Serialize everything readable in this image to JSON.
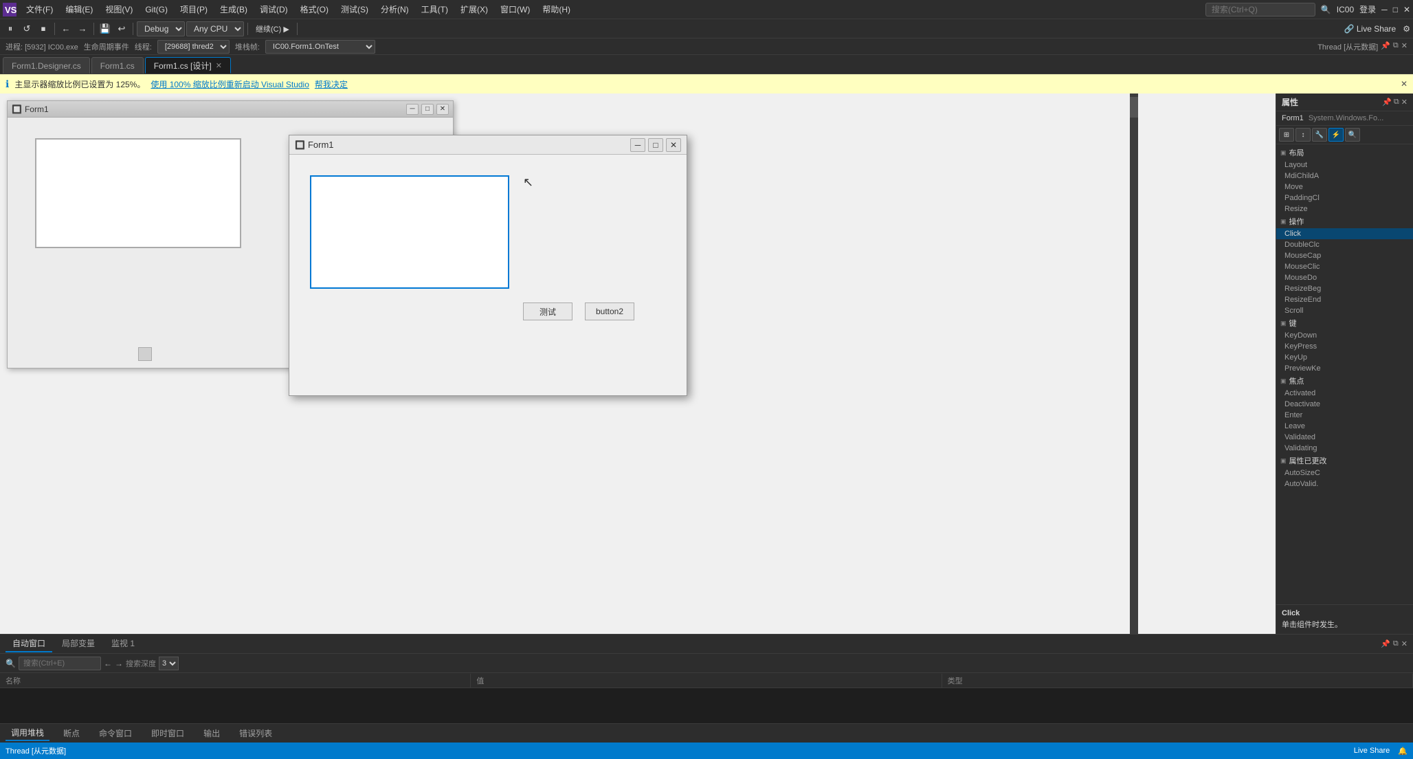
{
  "app": {
    "logo": "VS",
    "title": "Visual Studio"
  },
  "menu": {
    "items": [
      "文件(F)",
      "编辑(E)",
      "视图(V)",
      "Git(G)",
      "项目(P)",
      "生成(B)",
      "调试(D)",
      "格式(O)",
      "测试(S)",
      "分析(N)",
      "工具(T)",
      "扩展(X)",
      "窗口(W)",
      "帮助(H)"
    ],
    "search_placeholder": "搜索(Ctrl+Q)",
    "user": "IC00",
    "login": "登录"
  },
  "toolbar": {
    "debug_config": "Debug",
    "platform": "Any CPU",
    "run_label": "继续(C) ▶"
  },
  "debug_bar": {
    "process": "进程: [5932] IC00.exe",
    "lifecycle": "生命周期事件",
    "thread": "线程:",
    "thread_id": "[29688] thred2",
    "callstack": "堆栈帧:",
    "stack_val": "IC00.Form1.OnTest"
  },
  "tabs": [
    {
      "label": "Form1.Designer.cs",
      "active": false,
      "closable": false
    },
    {
      "label": "Form1.cs",
      "active": false,
      "closable": false
    },
    {
      "label": "Form1.cs [设计]",
      "active": true,
      "closable": true
    }
  ],
  "info_bar": {
    "icon": "ℹ",
    "message": "主显示器缩放比例已设置为 125%。",
    "action1": "使用 100% 缩放比例重新启动 Visual Studio",
    "action2": "帮我决定"
  },
  "designer": {
    "title": "Form1",
    "icon": "🔲"
  },
  "running_form": {
    "title": "Form1",
    "icon": "🔲",
    "button1": "测试",
    "button2": "button2"
  },
  "properties_panel": {
    "title": "属性",
    "pin_label": "📌",
    "form_name": "Form1",
    "form_type": "System.Windows.Fo...",
    "categories": [
      {
        "name": "布局",
        "items": [
          "Layout",
          "MdiChildA",
          "Move",
          "PaddingCl",
          "Resize"
        ]
      },
      {
        "name": "操作",
        "items": [
          "Click",
          "DoubleClc",
          "MouseCap",
          "MouseClic",
          "MouseDo",
          "ResizeBeg",
          "ResizeEnd",
          "Scroll"
        ]
      },
      {
        "name": "键",
        "items": [
          "KeyDown",
          "KeyPress",
          "KeyUp",
          "PreviewKe"
        ]
      },
      {
        "name": "焦点",
        "items": [
          "Activated",
          "Deactivate",
          "Enter",
          "Leave",
          "Validated",
          "Validating"
        ]
      },
      {
        "name": "属性已更改",
        "items": [
          "AutoSizeC",
          "AutoValid."
        ]
      }
    ],
    "selected_item": "Click",
    "description_title": "Click",
    "description_text": "单击组件时发生。"
  },
  "bottom": {
    "auto_window_title": "自动窗口",
    "tabs": [
      "自动窗口",
      "局部变量",
      "监视 1"
    ],
    "active_tab": "自动窗口",
    "search_placeholder": "搜索(Ctrl+E)",
    "search_depth": "3",
    "columns": [
      "名称",
      "值",
      "类型"
    ]
  },
  "status_bar": {
    "debug_mode": "Thread [从元数据]",
    "right_items": [
      "Live Share",
      "🔔"
    ]
  },
  "bottom_tabs": [
    "调用堆栈",
    "断点",
    "命令窗口",
    "即时窗口",
    "输出",
    "错误列表"
  ]
}
